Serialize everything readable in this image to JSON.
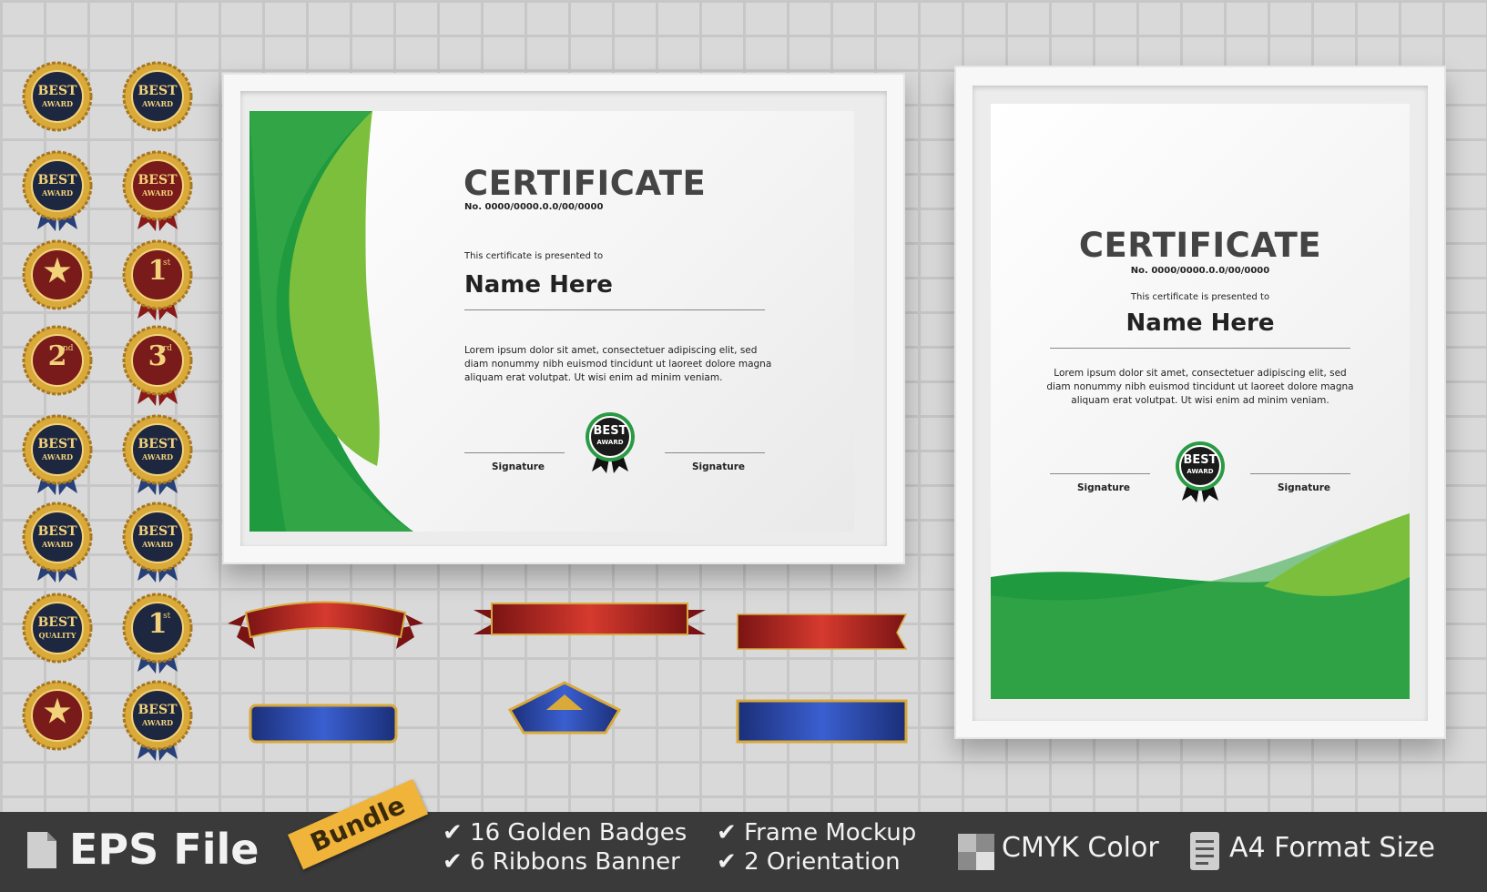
{
  "certificate_landscape": {
    "title": "CERTIFICATE",
    "number": "No. 0000/0000.0.0/00/0000",
    "presented": "This certificate is presented to",
    "name": "Name Here",
    "body": [
      "Lorem ipsum dolor sit amet, consectetuer adipiscing elit, sed",
      "diam nonummy nibh euismod tincidunt ut laoreet dolore magna",
      "aliquam erat volutpat. Ut wisi enim ad minim veniam."
    ],
    "signature_left": "Signature",
    "signature_right": "Signature",
    "seal_top": "BEST",
    "seal_bottom": "AWARD"
  },
  "certificate_portrait": {
    "title": "CERTIFICATE",
    "number": "No. 0000/0000.0.0/00/0000",
    "presented": "This certificate is presented to",
    "name": "Name Here",
    "body": [
      "Lorem ipsum dolor sit amet, consectetuer adipiscing elit, sed",
      "diam nonummy nibh euismod tincidunt ut laoreet dolore magna",
      "aliquam erat volutpat. Ut wisi enim ad minim veniam."
    ],
    "signature_left": "Signature",
    "signature_right": "Signature",
    "seal_top": "BEST",
    "seal_bottom": "AWARD"
  },
  "badges": [
    {
      "top": "BEST",
      "bottom": "AWARD"
    },
    {
      "top": "BEST",
      "bottom": "AWARD"
    },
    {
      "top": "BEST",
      "bottom": "AWARD"
    },
    {
      "top": "BEST",
      "bottom": "AWARD"
    },
    {
      "top": "★",
      "bottom": ""
    },
    {
      "top": "1",
      "sup": "st"
    },
    {
      "top": "2",
      "sup": "nd"
    },
    {
      "top": "3",
      "sup": "rd"
    },
    {
      "top": "BEST",
      "bottom": "AWARD"
    },
    {
      "top": "BEST",
      "bottom": "AWARD"
    },
    {
      "top": "BEST",
      "bottom": "AWARD"
    },
    {
      "top": "BEST",
      "bottom": "AWARD"
    },
    {
      "top": "BEST",
      "bottom": "QUALITY"
    },
    {
      "top": "1",
      "sup": "st"
    },
    {
      "top": "★",
      "bottom": ""
    },
    {
      "top": "BEST",
      "bottom": "AWARD"
    }
  ],
  "colors": {
    "green_dark": "#1f9a3f",
    "green_light": "#7cbf3c",
    "gold": "#d9a93a",
    "navy": "#1d2740",
    "maroon": "#7a1b1b",
    "red_ribbon": "#b8201f",
    "blue_ribbon": "#243f9a",
    "bar": "#3a3a3a",
    "bundle": "#f0b43a"
  },
  "footer": {
    "file_icon": "file-icon",
    "file_label": "EPS File",
    "bundle_label": "Bundle",
    "features": [
      "16 Golden Badges",
      "6  Ribbons Banner",
      "Frame Mockup",
      "2 Orientation"
    ],
    "cmyk_label": "CMYK Color",
    "format_label": "A4 Format Size"
  }
}
